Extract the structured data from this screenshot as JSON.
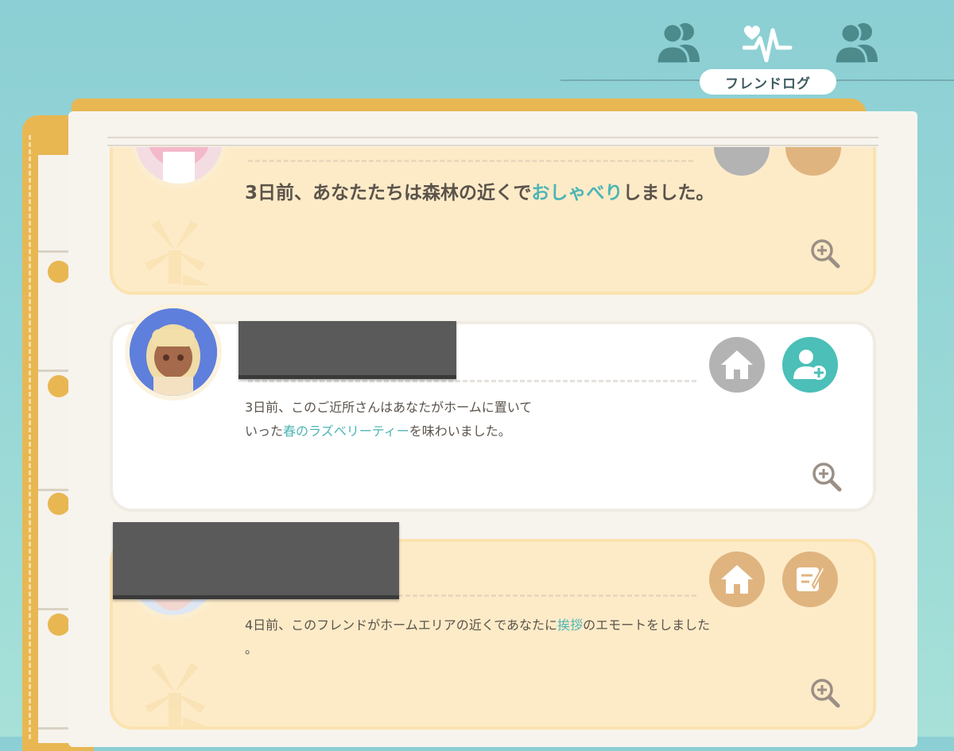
{
  "nav": {
    "active_label": "フレンドログ",
    "icons": [
      "friends-icon",
      "heartbeat-icon",
      "friends-icon"
    ]
  },
  "entries": [
    {
      "style": "beige",
      "text_before": "3日前、あなたたちは森林の近くで",
      "highlight": "おしゃべり",
      "text_after": "しました。"
    },
    {
      "style": "white",
      "line1": "3日前、このご近所さんはあなたがホームに置いて",
      "line2_before": "いった",
      "highlight": "春のラズベリーティー",
      "line2_after": "を味わいました。"
    },
    {
      "style": "beige",
      "line1_before": "4日前、このフレンドがホームエリアの近くであなたに",
      "highlight": "挨拶",
      "line1_after": "のエモートをしました",
      "line2": "。"
    }
  ],
  "colors": {
    "accent_teal": "#4bbfb8",
    "highlight_text": "#4db5b5",
    "home_button_gray": "#b3b3b3",
    "home_button_tan": "#e0b47f",
    "card_beige": "#fdebc8",
    "book_orange": "#e8b752"
  }
}
